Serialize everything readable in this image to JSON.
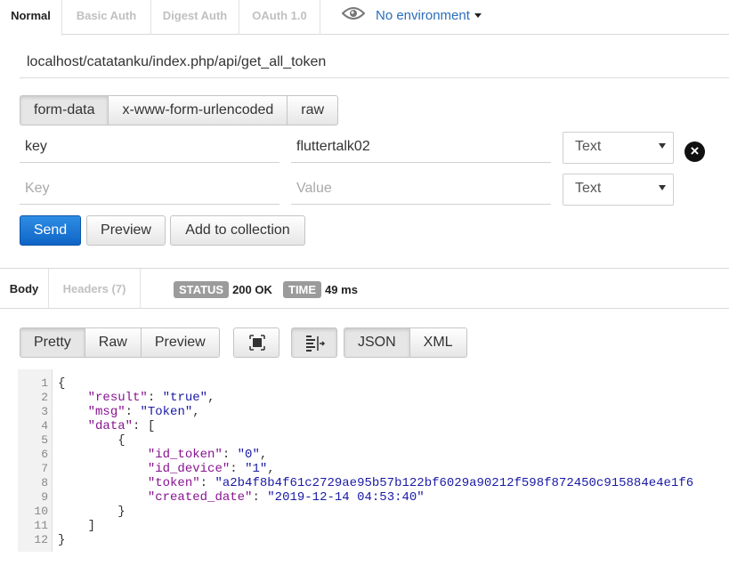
{
  "auth_tabs": [
    "Normal",
    "Basic Auth",
    "Digest Auth",
    "OAuth 1.0"
  ],
  "environment": {
    "label": "No environment",
    "icon": "eye-icon"
  },
  "request": {
    "url": "localhost/catatanku/index.php/api/get_all_token"
  },
  "body_mode_tabs": [
    "form-data",
    "x-www-form-urlencoded",
    "raw"
  ],
  "params": {
    "row1": {
      "key": "key",
      "value": "fluttertalk02",
      "type": "Text"
    },
    "row2": {
      "key_placeholder": "Key",
      "value_placeholder": "Value",
      "type": "Text"
    }
  },
  "actions": {
    "send": "Send",
    "preview": "Preview",
    "add_to_collection": "Add to collection"
  },
  "response": {
    "tabs": [
      "Body",
      "Headers (7)"
    ],
    "status_label": "STATUS",
    "status_value": "200 OK",
    "time_label": "TIME",
    "time_value": "49 ms",
    "view_tabs": [
      "Pretty",
      "Raw",
      "Preview"
    ],
    "format_tabs": [
      "JSON",
      "XML"
    ]
  },
  "json": {
    "result_key": "\"result\"",
    "result_val": "\"true\"",
    "msg_key": "\"msg\"",
    "msg_val": "\"Token\"",
    "data_key": "\"data\"",
    "id_token_key": "\"id_token\"",
    "id_token_val": "\"0\"",
    "id_device_key": "\"id_device\"",
    "id_device_val": "\"1\"",
    "token_key": "\"token\"",
    "token_val": "\"a2b4f8b4f61c2729ae95b57b122bf6029a90212f598f872450c915884e4e1f6",
    "created_key": "\"created_date\"",
    "created_val": "\"2019-12-14 04:53:40\""
  },
  "line_numbers": [
    "1",
    "2",
    "3",
    "4",
    "5",
    "6",
    "7",
    "8",
    "9",
    "10",
    "11",
    "12"
  ]
}
